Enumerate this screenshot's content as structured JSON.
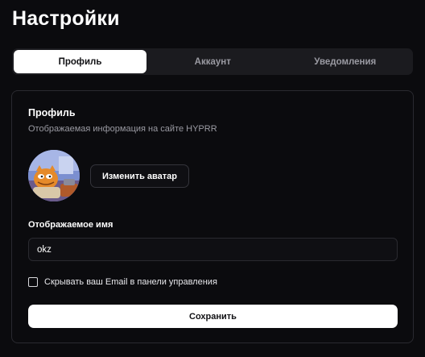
{
  "page": {
    "title": "Настройки"
  },
  "tabs": [
    {
      "label": "Профиль",
      "active": true
    },
    {
      "label": "Аккаунт",
      "active": false
    },
    {
      "label": "Уведомления",
      "active": false
    }
  ],
  "profile": {
    "title": "Профиль",
    "subtitle": "Отображаемая информация на сайте HYPRR",
    "change_avatar_label": "Изменить аватар",
    "display_name_label": "Отображаемое имя",
    "display_name_value": "okz",
    "hide_email_label": "Скрывать ваш Email в панели управления",
    "hide_email_checked": false,
    "save_label": "Сохранить"
  },
  "colors": {
    "background": "#0b0b0e",
    "tab_bar": "#1b1b1f",
    "border": "#2a2a30",
    "accent": "#ffffff"
  }
}
